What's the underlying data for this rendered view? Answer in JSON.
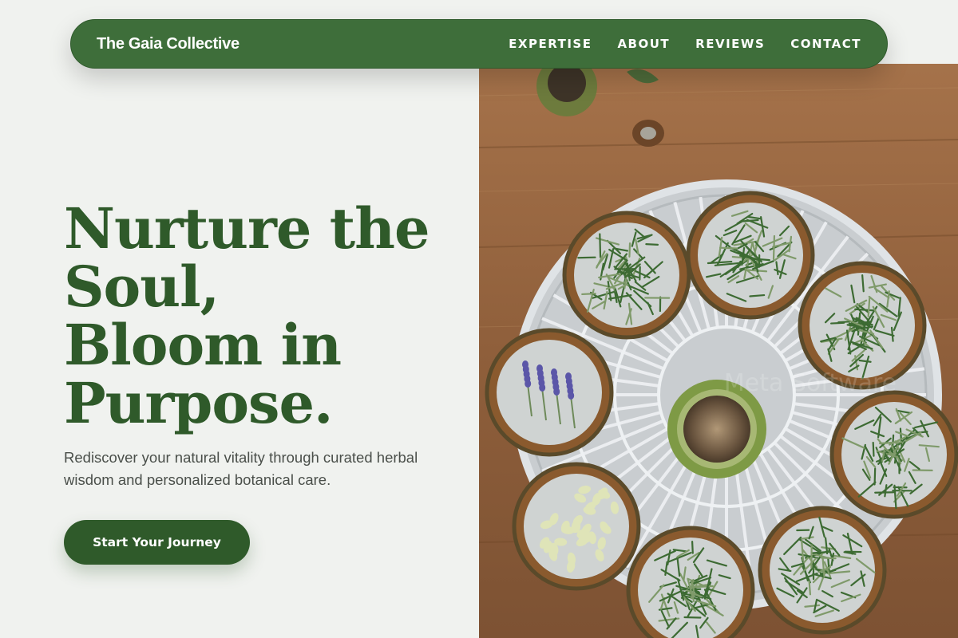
{
  "brand": {
    "name": "The Gaia Collective"
  },
  "nav": {
    "items": [
      "EXPERTISE",
      "ABOUT",
      "REVIEWS",
      "CONTACT"
    ]
  },
  "hero": {
    "headline_lines": [
      "Nurture the",
      "Soul,",
      "Bloom in",
      "Purpose."
    ],
    "subtext": "Rediscover your natural vitality through curated herbal wisdom and personalized botanical care.",
    "cta_label": "Start Your Journey",
    "image_watermark": "Meta Software"
  },
  "colors": {
    "page_bg": "#f0f2ef",
    "nav_bg": "#3e6e3a",
    "accent": "#2f5a2a",
    "body_text": "#4a4f4a",
    "wood": "#9b6a40"
  },
  "icons": [
    "herb-drying-tray-photo"
  ]
}
